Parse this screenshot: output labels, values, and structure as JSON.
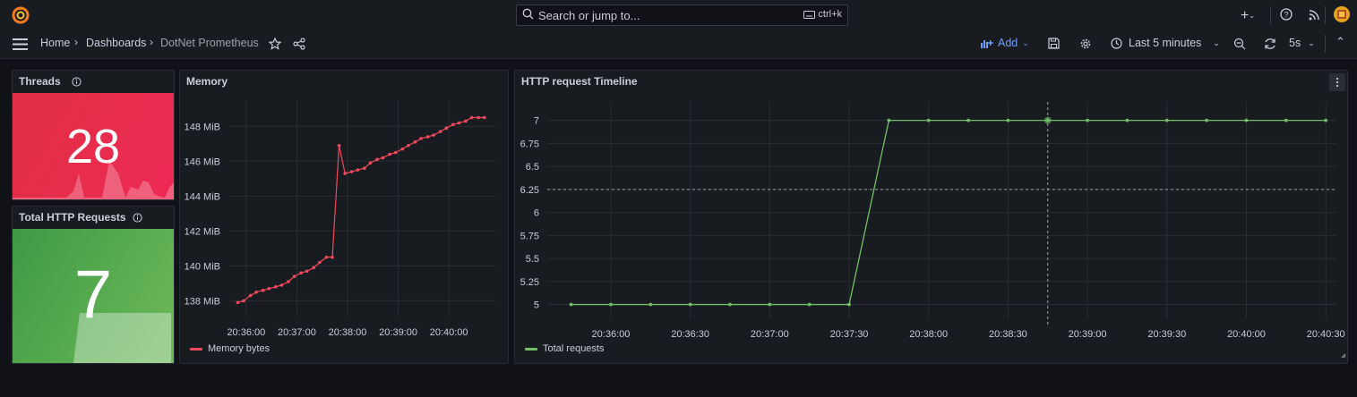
{
  "colors": {
    "accent": "#6e9fff",
    "red": "#f2495c",
    "green": "#73bf69",
    "bg": "#111217",
    "panel": "#181b1f"
  },
  "topbar": {
    "search_placeholder": "Search or jump to...",
    "search_shortcut": "ctrl+k",
    "icons": [
      "grafana-logo-icon",
      "plus-icon",
      "help-icon",
      "rss-icon",
      "avatar"
    ]
  },
  "breadcrumb": {
    "home": "Home",
    "dashboards": "Dashboards",
    "current": "DotNet Prometheus"
  },
  "toolbar": {
    "add_label": "Add",
    "time_range": "Last 5 minutes",
    "refresh_interval": "5s"
  },
  "panels": {
    "threads": {
      "title": "Threads",
      "value": "28"
    },
    "http_requests": {
      "title": "Total HTTP Requests",
      "value": "7"
    },
    "memory": {
      "title": "Memory",
      "legend": "Memory bytes",
      "yticks": [
        "148 MiB",
        "146 MiB",
        "144 MiB",
        "142 MiB",
        "140 MiB",
        "138 MiB"
      ],
      "xticks": [
        "20:36:00",
        "20:37:00",
        "20:38:00",
        "20:39:00",
        "20:40:00"
      ]
    },
    "timeline": {
      "title": "HTTP request Timeline",
      "legend": "Total requests",
      "yticks": [
        "7",
        "6.75",
        "6.5",
        "6.25",
        "6",
        "5.75",
        "5.5",
        "5.25",
        "5"
      ],
      "xticks": [
        "20:36:00",
        "20:36:30",
        "20:37:00",
        "20:37:30",
        "20:38:00",
        "20:38:30",
        "20:39:00",
        "20:39:30",
        "20:40:00",
        "20:40:30"
      ]
    }
  },
  "chart_data": [
    {
      "type": "line",
      "title": "Memory",
      "ylabel": "",
      "xlabel": "",
      "ylim": [
        137,
        149.5
      ],
      "series": [
        {
          "name": "Memory bytes",
          "color": "#f2495c",
          "x": [
            "20:35:50",
            "20:35:57",
            "20:36:05",
            "20:36:12",
            "20:36:20",
            "20:36:27",
            "20:36:35",
            "20:36:42",
            "20:36:50",
            "20:36:57",
            "20:37:05",
            "20:37:12",
            "20:37:20",
            "20:37:27",
            "20:37:35",
            "20:37:42",
            "20:37:50",
            "20:37:57",
            "20:38:05",
            "20:38:12",
            "20:38:20",
            "20:38:27",
            "20:38:35",
            "20:38:42",
            "20:38:50",
            "20:38:57",
            "20:39:05",
            "20:39:12",
            "20:39:20",
            "20:39:27",
            "20:39:35",
            "20:39:42",
            "20:39:50",
            "20:39:57",
            "20:40:05",
            "20:40:12",
            "20:40:20",
            "20:40:27",
            "20:40:35",
            "20:40:42"
          ],
          "values": [
            137.9,
            138.0,
            138.3,
            138.5,
            138.6,
            138.7,
            138.8,
            138.9,
            139.1,
            139.4,
            139.6,
            139.7,
            139.9,
            140.2,
            140.5,
            140.5,
            146.9,
            145.3,
            145.4,
            145.5,
            145.6,
            145.9,
            146.1,
            146.2,
            146.4,
            146.5,
            146.7,
            146.9,
            147.1,
            147.3,
            147.4,
            147.5,
            147.7,
            147.9,
            148.1,
            148.2,
            148.3,
            148.5,
            148.5,
            148.5
          ]
        }
      ]
    },
    {
      "type": "line",
      "title": "HTTP request Timeline",
      "ylim": [
        4.8,
        7.2
      ],
      "series": [
        {
          "name": "Total requests",
          "color": "#73bf69",
          "x": [
            "20:35:45",
            "20:36:00",
            "20:36:15",
            "20:36:30",
            "20:36:45",
            "20:37:00",
            "20:37:15",
            "20:37:30",
            "20:37:45",
            "20:38:00",
            "20:38:15",
            "20:38:30",
            "20:38:45",
            "20:39:00",
            "20:39:15",
            "20:39:30",
            "20:39:45",
            "20:40:00",
            "20:40:15",
            "20:40:30"
          ],
          "values": [
            5,
            5,
            5,
            5,
            5,
            5,
            5,
            5,
            7,
            7,
            7,
            7,
            7,
            7,
            7,
            7,
            7,
            7,
            7,
            7
          ]
        }
      ]
    }
  ]
}
